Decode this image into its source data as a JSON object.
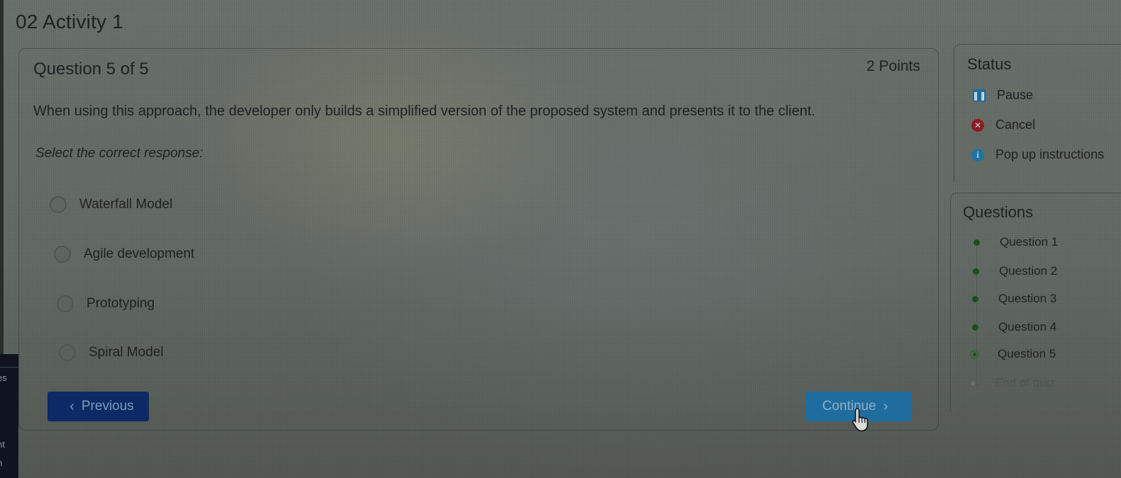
{
  "page": {
    "activity_title": "02 Activity 1"
  },
  "question": {
    "header": "Question 5 of 5",
    "points": "2 Points",
    "text": "When using this approach, the developer only builds a simplified version of the proposed system and presents it to the client.",
    "instruction": "Select the correct response:",
    "options": [
      {
        "label": "Waterfall Model",
        "selected": false
      },
      {
        "label": "Agile development",
        "selected": false
      },
      {
        "label": "Prototyping",
        "selected": false
      },
      {
        "label": "Spiral Model",
        "selected": false
      }
    ]
  },
  "navigation": {
    "previous_label": "Previous",
    "continue_label": "Continue",
    "previous_icon": "chevron-left-icon",
    "continue_icon": "chevron-right-icon"
  },
  "status_panel": {
    "title": "Status",
    "items": [
      {
        "label": "Pause",
        "icon": "pause-icon",
        "color": "#1d6e99"
      },
      {
        "label": "Cancel",
        "icon": "cancel-icon",
        "color": "#8c1d22"
      },
      {
        "label": "Pop up instructions",
        "icon": "info-icon",
        "color": "#2174a0"
      }
    ]
  },
  "questions_panel": {
    "title": "Questions",
    "items": [
      {
        "label": "Question 1",
        "state": "answered"
      },
      {
        "label": "Question 2",
        "state": "answered"
      },
      {
        "label": "Question 3",
        "state": "answered"
      },
      {
        "label": "Question 4",
        "state": "answered"
      },
      {
        "label": "Question 5",
        "state": "current"
      },
      {
        "label": "End of quiz",
        "state": "pending"
      }
    ]
  },
  "left_sidebar": {
    "fragments": [
      "es",
      "nt",
      "n"
    ]
  },
  "colors": {
    "previous_button": "#0b2a66",
    "continue_button": "#1f6c9f",
    "answered_dot": "#1c4d1e"
  }
}
